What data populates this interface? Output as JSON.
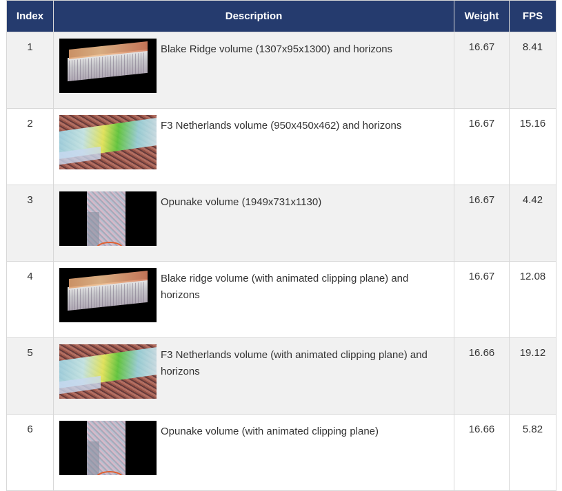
{
  "table": {
    "headers": {
      "index": "Index",
      "description": "Description",
      "weight": "Weight",
      "fps": "FPS"
    },
    "rows": [
      {
        "index": "1",
        "thumbnail": "blake-ridge",
        "description": "Blake Ridge volume (1307x95x1300) and horizons",
        "weight": "16.67",
        "fps": "8.41"
      },
      {
        "index": "2",
        "thumbnail": "f3-netherlands",
        "description": "F3 Netherlands volume (950x450x462) and horizons",
        "weight": "16.67",
        "fps": "15.16"
      },
      {
        "index": "3",
        "thumbnail": "opunake",
        "description": "Opunake volume (1949x731x1130)",
        "weight": "16.67",
        "fps": "4.42"
      },
      {
        "index": "4",
        "thumbnail": "blake-ridge",
        "description": "Blake ridge volume (with animated clipping plane) and horizons",
        "weight": "16.67",
        "fps": "12.08"
      },
      {
        "index": "5",
        "thumbnail": "f3-netherlands",
        "description": "F3 Netherlands volume (with animated clipping plane) and horizons",
        "weight": "16.66",
        "fps": "19.12"
      },
      {
        "index": "6",
        "thumbnail": "opunake",
        "description": "Opunake volume (with animated clipping plane)",
        "weight": "16.66",
        "fps": "5.82"
      }
    ]
  },
  "colors": {
    "header_bg": "#253b6e",
    "header_text": "#ffffff",
    "row_alt_bg": "#f1f1f1",
    "border": "#d8d8d8"
  }
}
